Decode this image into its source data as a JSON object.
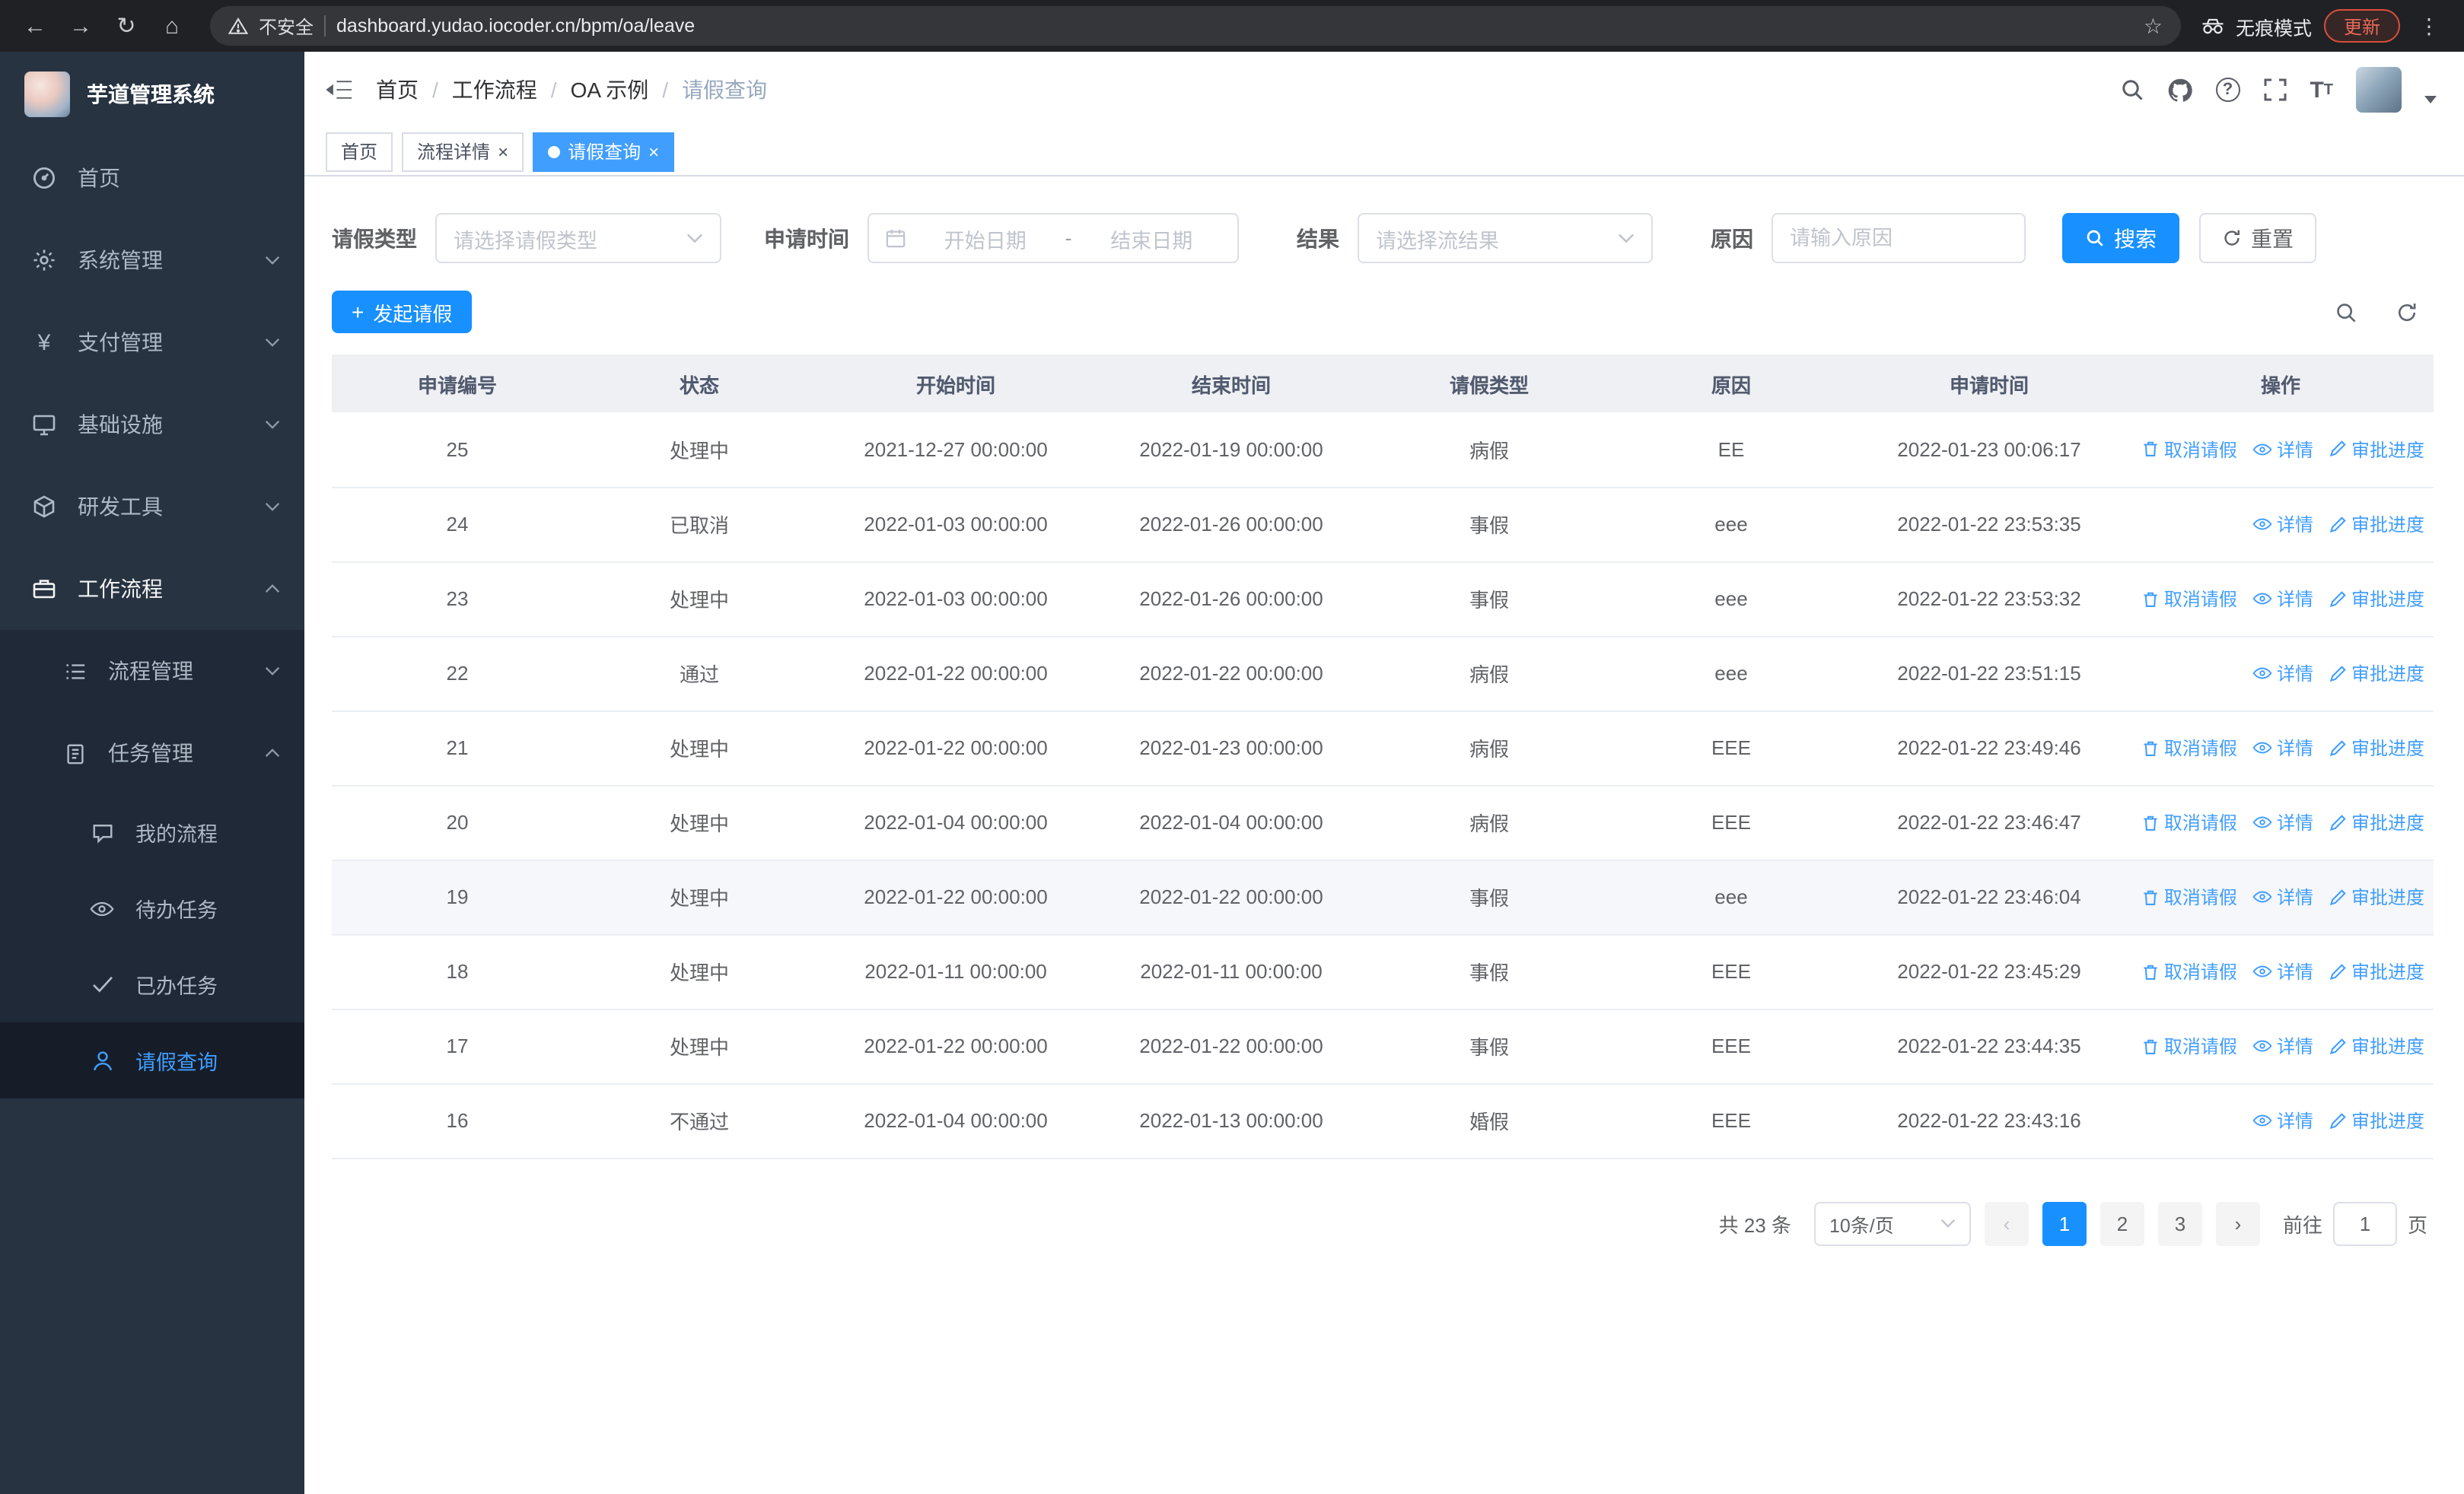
{
  "browser": {
    "security_warning": "不安全",
    "url": "dashboard.yudao.iocoder.cn/bpm/oa/leave",
    "incognito_label": "无痕模式",
    "update_label": "更新"
  },
  "sidebar": {
    "app_title": "芋道管理系统",
    "menu": [
      {
        "label": "首页"
      },
      {
        "label": "系统管理"
      },
      {
        "label": "支付管理"
      },
      {
        "label": "基础设施"
      },
      {
        "label": "研发工具"
      },
      {
        "label": "工作流程"
      }
    ],
    "workflow_children": [
      {
        "label": "流程管理"
      },
      {
        "label": "任务管理"
      }
    ],
    "task_children": [
      {
        "label": "我的流程"
      },
      {
        "label": "待办任务"
      },
      {
        "label": "已办任务"
      },
      {
        "label": "请假查询"
      }
    ]
  },
  "header": {
    "breadcrumb": [
      {
        "label": "首页"
      },
      {
        "label": "工作流程"
      },
      {
        "label": "OA 示例"
      },
      {
        "label": "请假查询"
      }
    ]
  },
  "tabs": [
    {
      "label": "首页"
    },
    {
      "label": "流程详情"
    },
    {
      "label": "请假查询"
    }
  ],
  "filters": {
    "leave_type_label": "请假类型",
    "leave_type_placeholder": "请选择请假类型",
    "apply_time_label": "申请时间",
    "start_date_placeholder": "开始日期",
    "range_separator": "-",
    "end_date_placeholder": "结束日期",
    "result_label": "结果",
    "result_placeholder": "请选择流结果",
    "reason_label": "原因",
    "reason_placeholder": "请输入原因",
    "search_label": "搜索",
    "reset_label": "重置"
  },
  "toolbar": {
    "create_label": "发起请假"
  },
  "table": {
    "headers": [
      "申请编号",
      "状态",
      "开始时间",
      "结束时间",
      "请假类型",
      "原因",
      "申请时间",
      "操作"
    ],
    "ops": {
      "cancel": "取消请假",
      "detail": "详情",
      "progress": "审批进度"
    },
    "rows": [
      {
        "id": "25",
        "status": "处理中",
        "start": "2021-12-27 00:00:00",
        "end": "2022-01-19 00:00:00",
        "type": "病假",
        "reason": "EE",
        "applied": "2022-01-23 00:06:17"
      },
      {
        "id": "24",
        "status": "已取消",
        "start": "2022-01-03 00:00:00",
        "end": "2022-01-26 00:00:00",
        "type": "事假",
        "reason": "eee",
        "applied": "2022-01-22 23:53:35"
      },
      {
        "id": "23",
        "status": "处理中",
        "start": "2022-01-03 00:00:00",
        "end": "2022-01-26 00:00:00",
        "type": "事假",
        "reason": "eee",
        "applied": "2022-01-22 23:53:32"
      },
      {
        "id": "22",
        "status": "通过",
        "start": "2022-01-22 00:00:00",
        "end": "2022-01-22 00:00:00",
        "type": "病假",
        "reason": "eee",
        "applied": "2022-01-22 23:51:15"
      },
      {
        "id": "21",
        "status": "处理中",
        "start": "2022-01-22 00:00:00",
        "end": "2022-01-23 00:00:00",
        "type": "病假",
        "reason": "EEE",
        "applied": "2022-01-22 23:49:46"
      },
      {
        "id": "20",
        "status": "处理中",
        "start": "2022-01-04 00:00:00",
        "end": "2022-01-04 00:00:00",
        "type": "病假",
        "reason": "EEE",
        "applied": "2022-01-22 23:46:47"
      },
      {
        "id": "19",
        "status": "处理中",
        "start": "2022-01-22 00:00:00",
        "end": "2022-01-22 00:00:00",
        "type": "事假",
        "reason": "eee",
        "applied": "2022-01-22 23:46:04"
      },
      {
        "id": "18",
        "status": "处理中",
        "start": "2022-01-11 00:00:00",
        "end": "2022-01-11 00:00:00",
        "type": "事假",
        "reason": "EEE",
        "applied": "2022-01-22 23:45:29"
      },
      {
        "id": "17",
        "status": "处理中",
        "start": "2022-01-22 00:00:00",
        "end": "2022-01-22 00:00:00",
        "type": "事假",
        "reason": "EEE",
        "applied": "2022-01-22 23:44:35"
      },
      {
        "id": "16",
        "status": "不通过",
        "start": "2022-01-04 00:00:00",
        "end": "2022-01-13 00:00:00",
        "type": "婚假",
        "reason": "EEE",
        "applied": "2022-01-22 23:43:16"
      }
    ]
  },
  "pagination": {
    "total": "共 23 条",
    "page_size": "10条/页",
    "pages": [
      "1",
      "2",
      "3"
    ],
    "goto_label": "前往",
    "goto_value": "1",
    "goto_suffix": "页"
  },
  "colors": {
    "primary_button": "#1890ff",
    "link": "#409eff",
    "active_tab": "#409eff",
    "sidebar_bg": "#273341",
    "chrome_update_red": "#d94f3b"
  }
}
